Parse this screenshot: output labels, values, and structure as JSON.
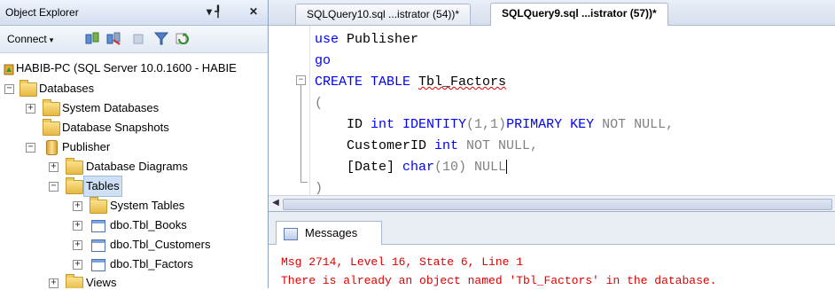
{
  "object_explorer": {
    "title": "Object Explorer",
    "pin_glyph": "▾ ┦",
    "close_glyph": "✕",
    "connect_label": "Connect",
    "toolbar_icons": [
      "connect-object-icon",
      "disconnect-icon",
      "stop-icon",
      "filter-icon",
      "refresh-icon"
    ],
    "tree": {
      "server": "HABIB-PC (SQL Server 10.0.1600 - HABIE",
      "databases": "Databases",
      "system_databases": "System Databases",
      "database_snapshots": "Database Snapshots",
      "publisher": "Publisher",
      "database_diagrams": "Database Diagrams",
      "tables": "Tables",
      "system_tables": "System Tables",
      "tbl_books": "dbo.Tbl_Books",
      "tbl_customers": "dbo.Tbl_Customers",
      "tbl_factors": "dbo.Tbl_Factors",
      "views": "Views"
    }
  },
  "tabs": [
    {
      "label": "SQLQuery10.sql ...istrator (54))*",
      "active": false
    },
    {
      "label": "SQLQuery9.sql ...istrator (57))*",
      "active": true
    }
  ],
  "editor": {
    "l1_kw": "use",
    "l1_tx": " Publisher",
    "l2_kw": "go",
    "l3_kw": "CREATE TABLE",
    "l3_tx": "Tbl_Factors",
    "l4_gr": "(",
    "l5_tx1": "    ID ",
    "l5_kw1": "int IDENTITY",
    "l5_gr1": "(1,1)",
    "l5_kw2": "PRIMARY KEY",
    "l5_gr2": " NOT NULL,",
    "l6_tx1": "    CustomerID ",
    "l6_kw1": "int",
    "l6_gr1": " NOT NULL,",
    "l7_tx1": "    [Date] ",
    "l7_kw1": "char",
    "l7_gr1": "(10) NULL",
    "l8_gr": ")"
  },
  "results": {
    "tab_label": "Messages",
    "line1": "Msg 2714, Level 16, State 6, Line 1",
    "line2": "There is already an object named 'Tbl_Factors' in the database."
  },
  "colors": {
    "keyword": "#0000ff",
    "gray": "#808080",
    "error": "#e00000",
    "selection": "#cfe0f5"
  }
}
